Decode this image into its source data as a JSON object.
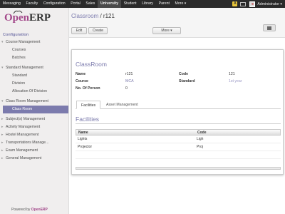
{
  "topnav": {
    "items": [
      "Messaging",
      "Faculty",
      "Configuration",
      "Portal",
      "Sales",
      "University",
      "Student",
      "Library",
      "Parent",
      "More ▾"
    ],
    "active_index": 5,
    "user_name": "Administrator ▾",
    "badge_text": "A"
  },
  "brand": {
    "logo_open": "Open",
    "logo_erp": "ERP",
    "powered_prefix": "Powered by",
    "powered_brand": "OpenERP"
  },
  "sidebar": {
    "section": "Configuration",
    "menu": [
      {
        "label": "Course Management",
        "kind": "top",
        "open": true
      },
      {
        "label": "Courses",
        "kind": "sub"
      },
      {
        "label": "Batches",
        "kind": "sub"
      },
      {
        "label": "Standard Management",
        "kind": "top",
        "open": true
      },
      {
        "label": "Standard",
        "kind": "sub"
      },
      {
        "label": "Division",
        "kind": "sub"
      },
      {
        "label": "Allocation Of Division",
        "kind": "sub"
      },
      {
        "label": "Class Room Management",
        "kind": "top",
        "open": true
      },
      {
        "label": "Class Room",
        "kind": "sub",
        "selected": true
      },
      {
        "label": "Subject(s) Management",
        "kind": "top"
      },
      {
        "label": "Activity Management",
        "kind": "top"
      },
      {
        "label": "Hostel Management",
        "kind": "top"
      },
      {
        "label": "Transportations Manage...",
        "kind": "top"
      },
      {
        "label": "Exam Management",
        "kind": "top"
      },
      {
        "label": "General Management",
        "kind": "top"
      }
    ]
  },
  "header": {
    "breadcrumb_link": "Classroom",
    "breadcrumb_sep": " / ",
    "breadcrumb_current": "r121",
    "edit_label": "Edit",
    "create_label": "Create",
    "more_label": "More ▾"
  },
  "form": {
    "title": "ClassRoom",
    "fields": {
      "name_label": "Name",
      "name_value": "r121",
      "code_label": "Code",
      "code_value": "121",
      "course_label": "Course",
      "course_value": "MCA",
      "standard_label": "Standard",
      "standard_value": "1st year",
      "persons_label": "No. Of Person",
      "persons_value": "0"
    },
    "tabs": [
      "Facilities",
      "Asset Management"
    ],
    "active_tab": 0,
    "section_title": "Facilities",
    "table": {
      "columns": [
        "Name",
        "Code"
      ],
      "rows": [
        {
          "name": "Lights",
          "code": "Ligh"
        },
        {
          "name": "Projector",
          "code": "Proj"
        }
      ]
    }
  },
  "colors": {
    "accent": "#7c7bad",
    "brand": "#a24689",
    "topbar": "#2b2b2b"
  }
}
